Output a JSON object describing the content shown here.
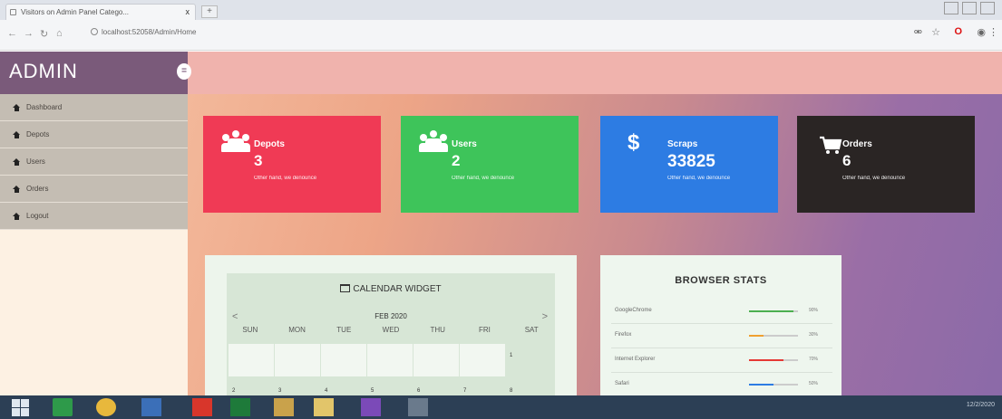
{
  "browser": {
    "tab_title": "Visitors on Admin Panel Catego...",
    "tab_close": "x",
    "new_tab": "+",
    "url": "localhost:52058/Admin/Home"
  },
  "app": {
    "brand": "ADMIN",
    "toggle": "="
  },
  "sidebar": {
    "items": [
      {
        "label": "Dashboard"
      },
      {
        "label": "Depots"
      },
      {
        "label": "Users"
      },
      {
        "label": "Orders"
      },
      {
        "label": "Logout"
      }
    ]
  },
  "cards": [
    {
      "title": "Depots",
      "value": "3",
      "subtitle": "Other hand, we denounce",
      "color": "#f03a55",
      "icon": "users-icon"
    },
    {
      "title": "Users",
      "value": "2",
      "subtitle": "Other hand, we denounce",
      "color": "#3ec45a",
      "icon": "users-icon"
    },
    {
      "title": "Scraps",
      "value": "33825",
      "subtitle": "Other hand, we denounce",
      "color": "#2d7ce3",
      "icon": "dollar-icon",
      "icon_glyph": "$"
    },
    {
      "title": "Orders",
      "value": "6",
      "subtitle": "Other hand, we denounce",
      "color": "#2a2524",
      "icon": "cart-icon"
    }
  ],
  "calendar": {
    "title": "CALENDAR WIDGET",
    "month": "FEB 2020",
    "prev": "<",
    "next": ">",
    "days": [
      "SUN",
      "MON",
      "TUE",
      "WED",
      "THU",
      "FRI",
      "SAT"
    ],
    "first_row_numbers": [
      "1"
    ],
    "second_row_numbers": [
      "2",
      "3",
      "4",
      "5",
      "6",
      "7",
      "8"
    ]
  },
  "browser_stats": {
    "title": "BROWSER STATS",
    "rows": [
      {
        "name": "GoogleChrome",
        "pct_label": "90%",
        "value": 0.9,
        "color": "#4caf50"
      },
      {
        "name": "Firefox",
        "pct_label": "30%",
        "value": 0.3,
        "color": "#f0a030"
      },
      {
        "name": "Internet Explorer",
        "pct_label": "70%",
        "value": 0.7,
        "color": "#e53935"
      },
      {
        "name": "Safari",
        "pct_label": "50%",
        "value": 0.5,
        "color": "#2d7ce3"
      }
    ]
  },
  "taskbar": {
    "clock": "12/2/2020"
  }
}
